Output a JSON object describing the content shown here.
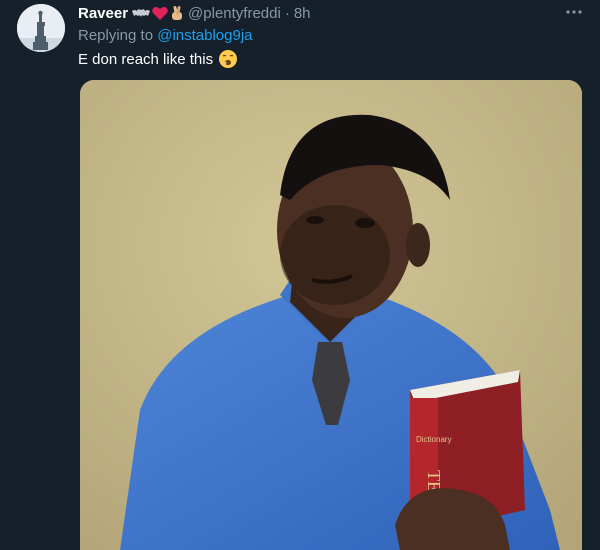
{
  "tweet": {
    "author_name": "Raveer",
    "author_emojis": [
      "bat-emoji",
      "heart-emoji",
      "crossed-fingers-emoji"
    ],
    "handle": "@plentyfreddi",
    "separator": "·",
    "timestamp": "8h",
    "more_icon": "ellipsis-icon",
    "replying_prefix": "Replying to",
    "replying_to": "@instablog9ja",
    "text": "E don reach like this",
    "text_emoji": "yawning-face-emoji",
    "media": {
      "description_icon": "photo",
      "book_spine_text_top": "Dictionary",
      "book_spine_text": "TEACHI"
    }
  },
  "colors": {
    "background": "#15202b",
    "secondary_text": "#8899a6",
    "link": "#1da1f2",
    "heart": "#e0245e"
  }
}
